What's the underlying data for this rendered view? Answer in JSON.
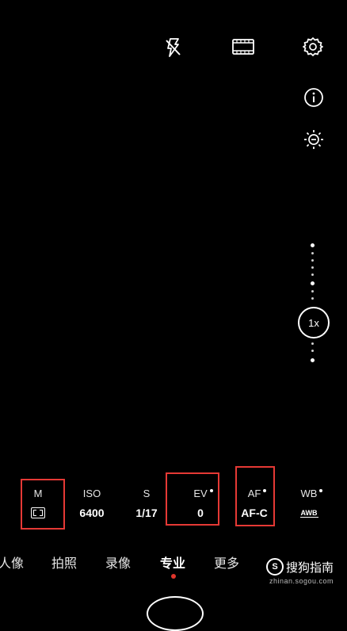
{
  "top_icons": [
    "flash-off-icon",
    "video-frame-icon",
    "settings-icon"
  ],
  "side_icons": [
    "info-icon",
    "brightness-icon"
  ],
  "zoom": {
    "label": "1x"
  },
  "params": [
    {
      "label": "M",
      "value_icon": "metering-icon",
      "has_dot": false
    },
    {
      "label": "ISO",
      "value": "6400",
      "has_dot": false
    },
    {
      "label": "S",
      "value": "1/17",
      "has_dot": false
    },
    {
      "label": "EV",
      "value": "0",
      "has_dot": true
    },
    {
      "label": "AF",
      "value": "AF-C",
      "has_dot": true
    },
    {
      "label": "WB",
      "value": "AWB",
      "has_dot": true
    }
  ],
  "modes": [
    "人像",
    "拍照",
    "录像",
    "专业",
    "更多"
  ],
  "active_mode": "专业",
  "watermark": {
    "logo": "S",
    "text": "搜狗指南",
    "sub": "zhinan.sogou.com"
  },
  "colors": {
    "highlight": "#e53935",
    "active_dot": "#e0352b"
  }
}
